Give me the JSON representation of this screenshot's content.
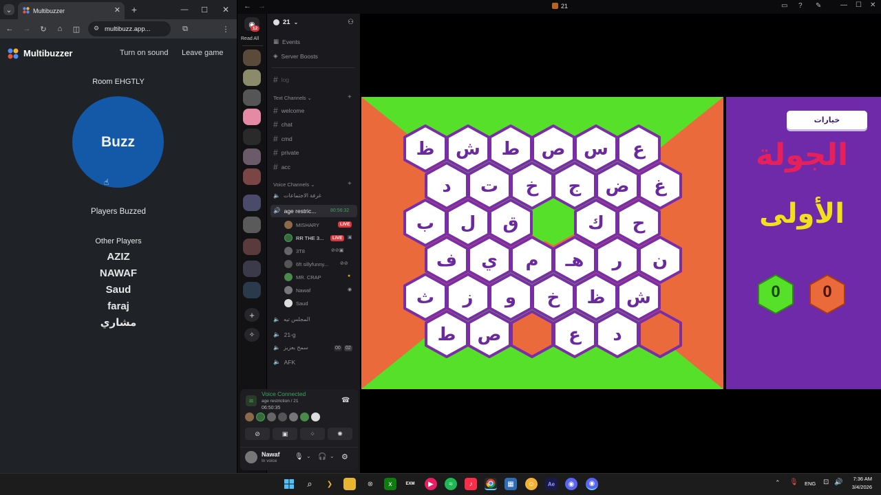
{
  "chrome": {
    "tab_title": "Multibuzzer",
    "url": "multibuzz.app...",
    "window_controls": [
      "minimize-icon",
      "maximize-icon",
      "close-icon"
    ]
  },
  "multibuzzer": {
    "brand": "Multibuzzer",
    "turn_on_sound": "Turn on sound",
    "leave_game": "Leave game",
    "room": "Room EHGTLY",
    "buzz": "Buzz",
    "players_buzzed": "Players Buzzed",
    "other_players_title": "Other Players",
    "other_players": [
      "AZIZ",
      "NAWAF",
      "Saud",
      "faraj",
      "مشاري"
    ],
    "buzz_color": "#1458a8"
  },
  "discord": {
    "window_title": "21",
    "server_name": "21",
    "rail_badge": "12",
    "read_all": "Read All",
    "events": "Events",
    "server_boosts": "Server Boosts",
    "log_channel": "log",
    "text_channels_header": "Text Channels",
    "text_channels": [
      "welcome",
      "chat",
      "cmd",
      "private",
      "acc"
    ],
    "voice_channels_header": "Voice Channels",
    "voice_channels_top": [
      "غرفة الاجتماعات"
    ],
    "active_voice_channel": "age restric...",
    "active_voice_timer": "80:56:32",
    "voice_users": [
      {
        "name": "MISHARY",
        "live": "LIVE"
      },
      {
        "name": "RR THE 3...",
        "live": "LIVE"
      },
      {
        "name": "3T8",
        "live": ""
      },
      {
        "name": "6ft sillyfunny...",
        "live": ""
      },
      {
        "name": "MR. CRAP",
        "live": ""
      },
      {
        "name": "Nawaf",
        "live": ""
      },
      {
        "name": "Saud",
        "live": ""
      }
    ],
    "voice_channels_bottom": [
      "المجلس تيه",
      "21-g",
      "سمح بعزيز",
      "AFK"
    ],
    "voice_counter_a": "00",
    "voice_counter_b": "02",
    "voice_connected": "Voice Connected",
    "voice_location": "age restriction / 21",
    "voice_elapsed": "06:50:35",
    "user_name": "Nawaf",
    "user_status": "In voice"
  },
  "game": {
    "options_label": "خيارات",
    "round_line1": "الجولة",
    "round_line2": "الأولى",
    "score_green": "0",
    "score_orange": "0",
    "colors": {
      "green": "#57e02a",
      "orange": "#ea6a3c",
      "purple": "#6a2a9e",
      "hex_border": "#7a2ea6"
    },
    "hex_rows": [
      [
        {
          "l": "ظ",
          "s": "white"
        },
        {
          "l": "ش",
          "s": "white"
        },
        {
          "l": "ط",
          "s": "white"
        },
        {
          "l": "ص",
          "s": "white"
        },
        {
          "l": "س",
          "s": "white"
        },
        {
          "l": "ع",
          "s": "white"
        }
      ],
      [
        {
          "l": "د",
          "s": "white"
        },
        {
          "l": "ت",
          "s": "white"
        },
        {
          "l": "خ",
          "s": "white"
        },
        {
          "l": "ج",
          "s": "white"
        },
        {
          "l": "ض",
          "s": "white"
        },
        {
          "l": "غ",
          "s": "white"
        }
      ],
      [
        {
          "l": "ب",
          "s": "white"
        },
        {
          "l": "ل",
          "s": "white"
        },
        {
          "l": "ق",
          "s": "white"
        },
        {
          "l": "",
          "s": "green"
        },
        {
          "l": "ك",
          "s": "white"
        },
        {
          "l": "ح",
          "s": "white"
        }
      ],
      [
        {
          "l": "ف",
          "s": "white"
        },
        {
          "l": "ي",
          "s": "white"
        },
        {
          "l": "م",
          "s": "white"
        },
        {
          "l": "هـ",
          "s": "white"
        },
        {
          "l": "ر",
          "s": "white"
        },
        {
          "l": "ن",
          "s": "white"
        }
      ],
      [
        {
          "l": "ث",
          "s": "white"
        },
        {
          "l": "ز",
          "s": "white"
        },
        {
          "l": "و",
          "s": "white"
        },
        {
          "l": "خ",
          "s": "white"
        },
        {
          "l": "ظ",
          "s": "white"
        },
        {
          "l": "ش",
          "s": "white"
        }
      ],
      [
        {
          "l": "ط",
          "s": "white"
        },
        {
          "l": "ص",
          "s": "white"
        },
        {
          "l": "",
          "s": "orange"
        },
        {
          "l": "ع",
          "s": "white"
        },
        {
          "l": "د",
          "s": "white"
        },
        {
          "l": "",
          "s": "orange"
        }
      ]
    ]
  },
  "taskbar": {
    "language": "ENG",
    "time": "7:36 AM",
    "date": "3/4/2026"
  }
}
